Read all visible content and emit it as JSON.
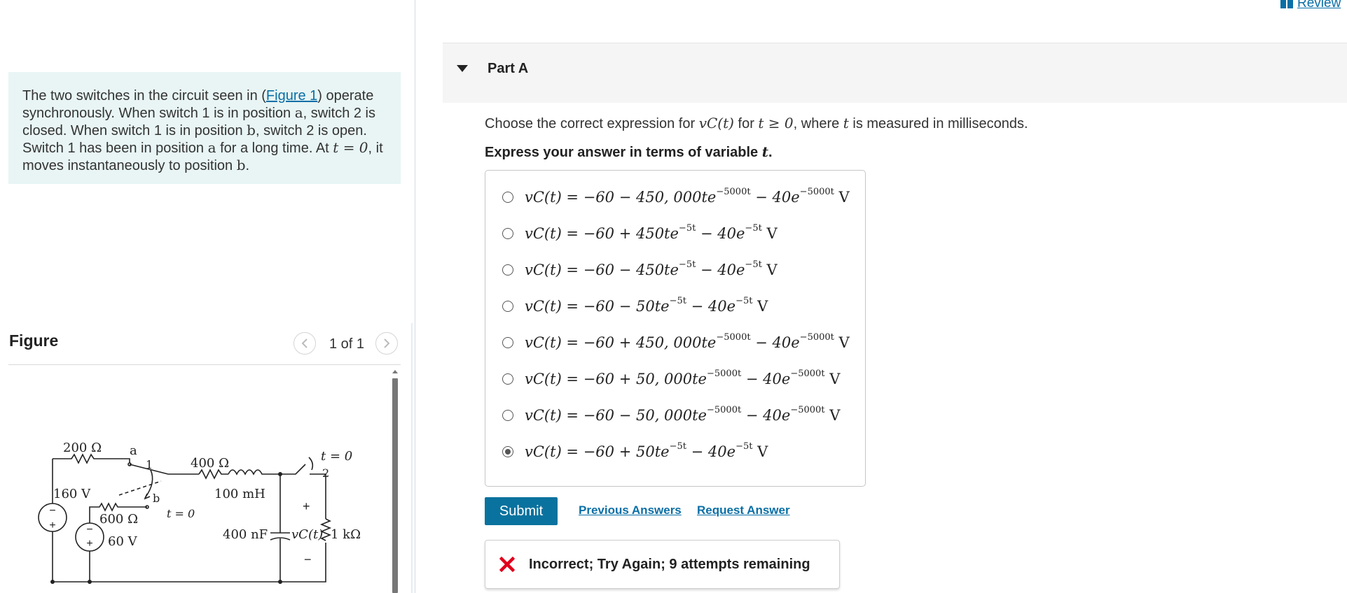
{
  "problem": {
    "text_1": "The two switches in the circuit seen in (",
    "figure_link": "Figure 1",
    "text_2": ") operate synchronously. When switch 1 is in position ",
    "pos_a": "a",
    "text_3": ", switch 2 is closed. When switch 1 is in position ",
    "pos_b": "b",
    "text_4": ", switch 2 is open. Switch 1 has been in position ",
    "pos_a2": "a",
    "text_5": " for a long time. At ",
    "time_eq": "t = 0",
    "text_6": ", it moves instantaneously to position ",
    "pos_b2": "b",
    "text_7": "."
  },
  "figure": {
    "title": "Figure",
    "counter": "1 of 1",
    "circuit_labels": {
      "r200": "200 Ω",
      "a": "a",
      "sw1_pos1": "1",
      "r400": "400 Ω",
      "t0_sw2": "t = 0",
      "sw2_pos2": "2",
      "v160": "160 V",
      "b": "b",
      "l100": "100 mH",
      "plus_cap": "+",
      "r600": "600 Ω",
      "t0_sw1": "t = 0",
      "c400": "400 nF",
      "vc": "vC(t)",
      "r1k": "1 kΩ",
      "v60": "60 V",
      "minus_cap": "−"
    }
  },
  "header": {
    "review_label": "Review"
  },
  "part": {
    "title": "Part A",
    "question_1": "Choose the correct expression for ",
    "question_var": "vC(t)",
    "question_2": " for ",
    "question_cond": "t ≥ 0",
    "question_3": ", where ",
    "question_t": "t",
    "question_4": " is measured in milliseconds.",
    "instruction_1": "Express your answer in terms of variable ",
    "instruction_var": "t",
    "instruction_2": "."
  },
  "choices": [
    {
      "lhs": "vC(t) = −60 − 450, 000te",
      "exp1": "−5000t",
      "mid": " − 40e",
      "exp2": "−5000t",
      "unit": " V",
      "selected": false
    },
    {
      "lhs": "vC(t) = −60 + 450te",
      "exp1": "−5t",
      "mid": " − 40e",
      "exp2": "−5t",
      "unit": " V",
      "selected": false
    },
    {
      "lhs": "vC(t) = −60 − 450te",
      "exp1": "−5t",
      "mid": " − 40e",
      "exp2": "−5t",
      "unit": " V",
      "selected": false
    },
    {
      "lhs": "vC(t) = −60 − 50te",
      "exp1": "−5t",
      "mid": " − 40e",
      "exp2": "−5t",
      "unit": " V",
      "selected": false
    },
    {
      "lhs": "vC(t) = −60 + 450, 000te",
      "exp1": "−5000t",
      "mid": " − 40e",
      "exp2": "−5000t",
      "unit": " V",
      "selected": false
    },
    {
      "lhs": "vC(t) = −60 + 50, 000te",
      "exp1": "−5000t",
      "mid": " − 40e",
      "exp2": "−5000t",
      "unit": " V",
      "selected": false
    },
    {
      "lhs": "vC(t) = −60 − 50, 000te",
      "exp1": "−5000t",
      "mid": " − 40e",
      "exp2": "−5000t",
      "unit": " V",
      "selected": false
    },
    {
      "lhs": "vC(t) = −60 + 50te",
      "exp1": "−5t",
      "mid": " − 40e",
      "exp2": "−5t",
      "unit": " V",
      "selected": true
    }
  ],
  "actions": {
    "submit_label": "Submit",
    "previous_answers_label": "Previous Answers",
    "request_answer_label": "Request Answer"
  },
  "feedback": {
    "icon": "x-icon",
    "text": "Incorrect; Try Again; 9 attempts remaining",
    "icon_color": "#e0001b"
  },
  "colors": {
    "accent": "#0a729e",
    "link": "#0a6fa6",
    "problem_bg": "#e8f5f4"
  }
}
